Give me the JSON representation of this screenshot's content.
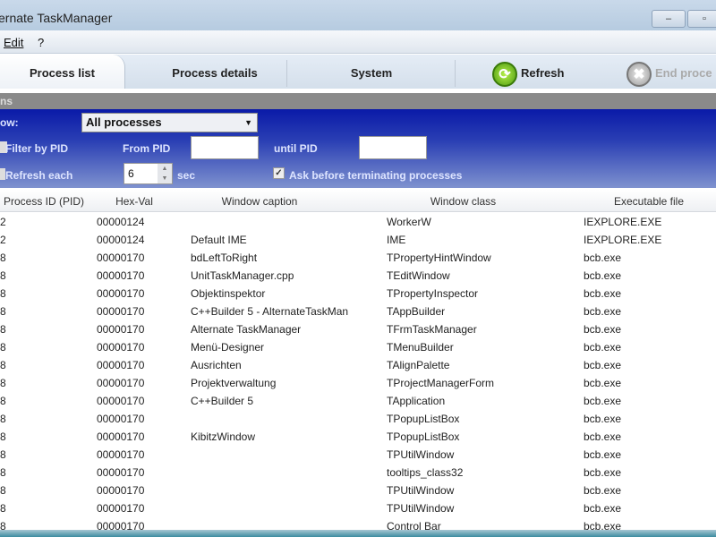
{
  "window": {
    "title": "ernate TaskManager",
    "minimize": "–",
    "maximize": "▫"
  },
  "menu": [
    "Edit",
    "?"
  ],
  "tabs": [
    "Process list",
    "Process details",
    "System"
  ],
  "toolbar": {
    "refresh": "Refresh",
    "end_process": "End proce",
    "refresh_icon": "refresh-icon",
    "end_icon": "close-circle-icon"
  },
  "options_header": "ns",
  "filters": {
    "show_label": "ow:",
    "show_value": "All processes",
    "filter_pid": "Filter by PID",
    "from_pid": "From PID",
    "from_value": "",
    "until_pid": "until PID",
    "until_value": "",
    "refresh_each": "Refresh each",
    "refresh_value": "6",
    "sec": "sec",
    "ask_terminate": "Ask before terminating processes",
    "ask_checked": true
  },
  "columns": [
    "Process ID (PID)",
    "Hex-Val",
    "Window caption",
    "Window class",
    "Executable file"
  ],
  "rows": [
    [
      "2",
      "00000124",
      "",
      "WorkerW",
      "IEXPLORE.EXE"
    ],
    [
      "2",
      "00000124",
      "Default IME",
      "IME",
      "IEXPLORE.EXE"
    ],
    [
      "8",
      "00000170",
      "bdLeftToRight",
      "TPropertyHintWindow",
      "bcb.exe"
    ],
    [
      "8",
      "00000170",
      "UnitTaskManager.cpp",
      "TEditWindow",
      "bcb.exe"
    ],
    [
      "8",
      "00000170",
      "Objektinspektor",
      "TPropertyInspector",
      "bcb.exe"
    ],
    [
      "8",
      "00000170",
      "C++Builder 5 - AlternateTaskMan",
      "TAppBuilder",
      "bcb.exe"
    ],
    [
      "8",
      "00000170",
      "Alternate TaskManager",
      "TFrmTaskManager",
      "bcb.exe"
    ],
    [
      "8",
      "00000170",
      "Menü-Designer",
      "TMenuBuilder",
      "bcb.exe"
    ],
    [
      "8",
      "00000170",
      "Ausrichten",
      "TAlignPalette",
      "bcb.exe"
    ],
    [
      "8",
      "00000170",
      "Projektverwaltung",
      "TProjectManagerForm",
      "bcb.exe"
    ],
    [
      "8",
      "00000170",
      "C++Builder 5",
      "TApplication",
      "bcb.exe"
    ],
    [
      "8",
      "00000170",
      "",
      "TPopupListBox",
      "bcb.exe"
    ],
    [
      "8",
      "00000170",
      "KibitzWindow",
      "TPopupListBox",
      "bcb.exe"
    ],
    [
      "8",
      "00000170",
      "",
      "TPUtilWindow",
      "bcb.exe"
    ],
    [
      "8",
      "00000170",
      "",
      "tooltips_class32",
      "bcb.exe"
    ],
    [
      "8",
      "00000170",
      "",
      "TPUtilWindow",
      "bcb.exe"
    ],
    [
      "8",
      "00000170",
      "",
      "TPUtilWindow",
      "bcb.exe"
    ],
    [
      "8",
      "00000170",
      "",
      "Control Bar",
      "bcb.exe"
    ]
  ]
}
